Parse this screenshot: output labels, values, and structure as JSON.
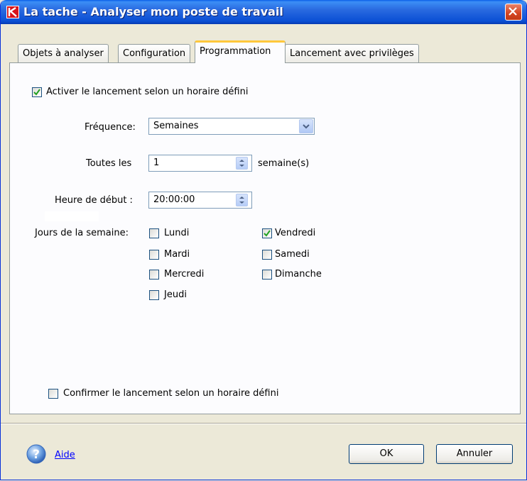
{
  "window": {
    "title": "La tache - Analyser mon poste de travail"
  },
  "tabs": [
    {
      "label": "Objets à analyser",
      "active": false
    },
    {
      "label": "Configuration",
      "active": false
    },
    {
      "label": "Programmation",
      "active": true
    },
    {
      "label": "Lancement avec privilèges",
      "active": false
    }
  ],
  "schedule": {
    "enable_label": "Activer le lancement selon un horaire défini",
    "enable_checked": true,
    "frequency_label": "Fréquence:",
    "frequency_value": "Semaines",
    "every_label": "Toutes les",
    "every_value": "1",
    "every_unit": "semaine(s)",
    "start_label": "Heure de début :",
    "start_value": "20:00:00",
    "days_label": "Jours de la semaine:",
    "days": [
      {
        "label": "Lundi",
        "checked": false
      },
      {
        "label": "Mardi",
        "checked": false
      },
      {
        "label": "Mercredi",
        "checked": false
      },
      {
        "label": "Jeudi",
        "checked": false
      },
      {
        "label": "Vendredi",
        "checked": true
      },
      {
        "label": "Samedi",
        "checked": false
      },
      {
        "label": "Dimanche",
        "checked": false
      }
    ],
    "confirm_label": "Confirmer le lancement selon un horaire défini",
    "confirm_checked": false
  },
  "footer": {
    "help_label": "Aide",
    "ok_label": "OK",
    "cancel_label": "Annuler"
  },
  "colors": {
    "titlebar": "#0a4fd4",
    "tab_highlight": "#ffc83c",
    "link": "#0000ff"
  }
}
